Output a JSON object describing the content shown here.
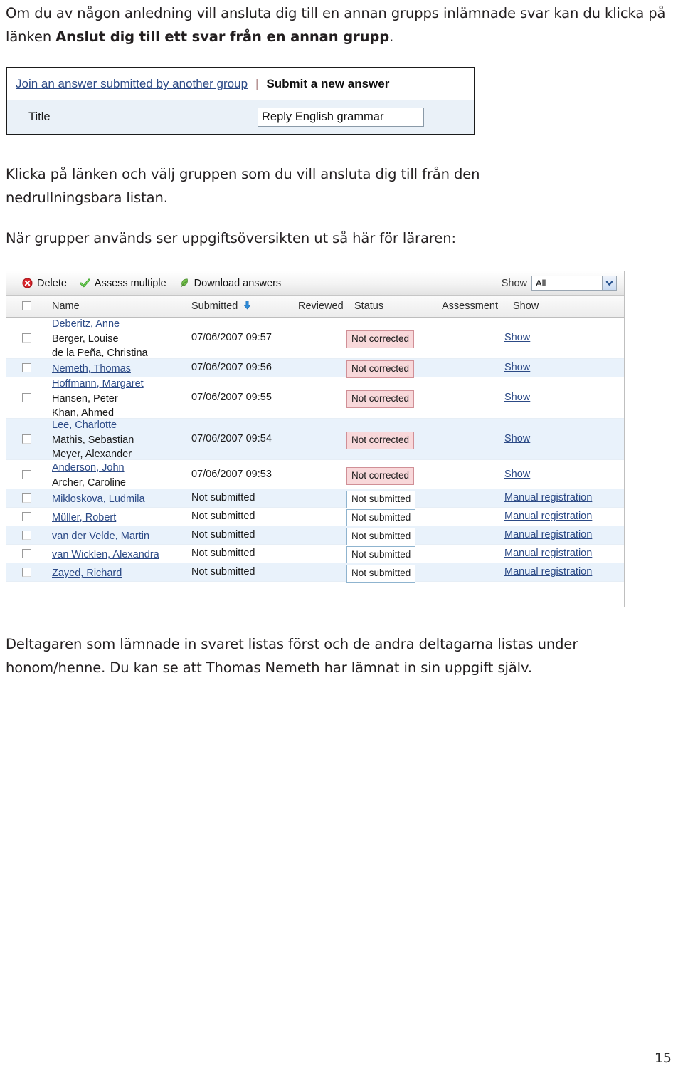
{
  "document": {
    "page_number": "15",
    "paragraphs": {
      "intro_part1": "Om du av någon anledning vill ansluta dig till en annan grupps inlämnade svar kan du klicka på länken ",
      "intro_bold": "Anslut dig till ett svar från en annan grupp",
      "intro_part2": ".",
      "click_link": "Klicka på länken och välj gruppen som du vill ansluta dig till från den nedrullningsbara listan.",
      "when_groups": "När grupper används ser uppgiftsöversikten ut så här för läraren:",
      "bottom": "Deltagaren som lämnade in svaret listas först och de andra deltagarna listas under honom/henne. Du kan se att Thomas Nemeth har lämnat in sin uppgift själv."
    }
  },
  "join_figure": {
    "tab_join_label": "Join an answer submitted by another group",
    "tab_separator": "|",
    "tab_submit_label": "Submit a new answer",
    "title_label": "Title",
    "title_value": "Reply English grammar"
  },
  "overview_figure": {
    "toolbar": {
      "delete_label": "Delete",
      "delete_icon": "delete-circle-x-icon",
      "assess_label": "Assess multiple",
      "assess_icon": "green-check-icon",
      "download_label": "Download answers",
      "download_icon": "download-leaf-icon",
      "show_label": "Show",
      "show_value": "All",
      "show_chevron_icon": "chevron-down-icon"
    },
    "columns": {
      "checkbox": "",
      "name": "Name",
      "submitted": "Submitted",
      "submitted_sort_icon": "sort-descending-arrow-icon",
      "reviewed": "Reviewed",
      "status": "Status",
      "assessment": "Assessment",
      "show": "Show"
    },
    "rows": [
      {
        "owner": "Deberitz, Anne",
        "members": [
          "Berger, Louise",
          "de la Peña, Christina"
        ],
        "submitted": "07/06/2007 09:57",
        "status": "Not corrected",
        "status_kind": "red",
        "action": "Show",
        "shaded": false
      },
      {
        "owner": "Nemeth, Thomas",
        "members": [],
        "submitted": "07/06/2007 09:56",
        "status": "Not corrected",
        "status_kind": "red",
        "action": "Show",
        "shaded": true
      },
      {
        "owner": "Hoffmann, Margaret",
        "members": [
          "Hansen, Peter",
          "Khan, Ahmed"
        ],
        "submitted": "07/06/2007 09:55",
        "status": "Not corrected",
        "status_kind": "red",
        "action": "Show",
        "shaded": false
      },
      {
        "owner": "Lee, Charlotte",
        "members": [
          "Mathis, Sebastian",
          "Meyer, Alexander"
        ],
        "submitted": "07/06/2007 09:54",
        "status": "Not corrected",
        "status_kind": "red",
        "action": "Show",
        "shaded": true
      },
      {
        "owner": "Anderson, John",
        "members": [
          "Archer, Caroline"
        ],
        "submitted": "07/06/2007 09:53",
        "status": "Not corrected",
        "status_kind": "red",
        "action": "Show",
        "shaded": false
      },
      {
        "owner": "Mikloskova, Ludmila",
        "members": [],
        "submitted": "Not submitted",
        "status": "Not submitted",
        "status_kind": "blue",
        "action": "Manual registration",
        "shaded": true
      },
      {
        "owner": "Müller, Robert",
        "members": [],
        "submitted": "Not submitted",
        "status": "Not submitted",
        "status_kind": "blue",
        "action": "Manual registration",
        "shaded": false
      },
      {
        "owner": "van der Velde, Martin",
        "members": [],
        "submitted": "Not submitted",
        "status": "Not submitted",
        "status_kind": "blue",
        "action": "Manual registration",
        "shaded": true
      },
      {
        "owner": "van Wicklen, Alexandra",
        "members": [],
        "submitted": "Not submitted",
        "status": "Not submitted",
        "status_kind": "blue",
        "action": "Manual registration",
        "shaded": false
      },
      {
        "owner": "Zayed, Richard",
        "members": [],
        "submitted": "Not submitted",
        "status": "Not submitted",
        "status_kind": "blue",
        "action": "Manual registration",
        "shaded": true
      }
    ]
  },
  "colors": {
    "link": "#2c4a86",
    "row_shade": "#e9f2fb",
    "badge_red_bg": "#f8d8da",
    "badge_red_border": "#d08f96",
    "badge_blue_border": "#8fb4cf",
    "sort_arrow": "#2e8bd8"
  }
}
